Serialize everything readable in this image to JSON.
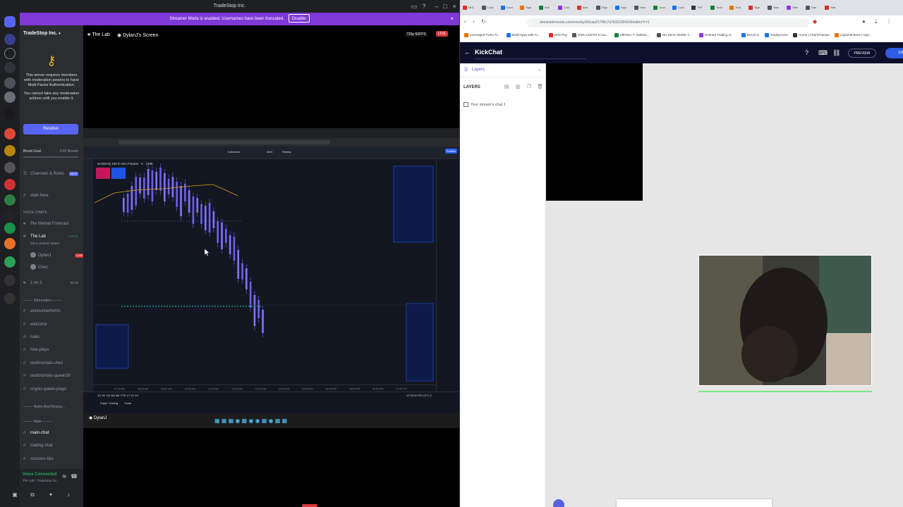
{
  "discord": {
    "window_title": "TradeStop Inc.",
    "banner_text": "Streamer Mode is enabled. Usernames have been truncated.",
    "banner_button": "Disable",
    "server_name": "TradeStop Inc.",
    "mfa_text_1": "This server requires members with moderation powers to have Multi-Factor Authentication.",
    "mfa_text_2": "You cannot take any moderation actions until you enable it.",
    "resolve_label": "Resolve",
    "boost_goal": "Boost Goal",
    "boost_count": "2/33 Boosts",
    "channels_roles": "Channels & Roles",
    "new_badge": "NEW",
    "start_here": "start-here",
    "voice_chats_cat": "VOICE CHATS",
    "pre_market": "Pre Market Forecast",
    "the_lab": "The Lab",
    "the_lab_time": "1:13:41",
    "channel_status": "Set a channel status",
    "user1": "DylanJ",
    "user2": "Chez",
    "live_badge": "LIVE",
    "one_on_one": "1 on 1",
    "one_on_one_count": "00",
    "one_on_one_max": "02",
    "info_cat": "Information",
    "announcements": "announcements",
    "welcome": "welcome",
    "rules": "rules",
    "free_plays": "free-plays",
    "testimonials_chez": "testimonials-chez",
    "testimonials_queen": "testimonials-queen30",
    "crypto": "crypto-queen-plays",
    "notes_cat": "Notes And Resour...",
    "main_cat": "Main",
    "main_chat": "main-chat",
    "trading_chat": "trading-chat",
    "success_tips": "success-tips",
    "voice_connected": "Voice Connected",
    "voice_sub": "The Lab / TradeStop Inc.",
    "stream_channel": "The Lab",
    "stream_screen": "DylanJ's Screen",
    "stream_quality": "720p 60FPS",
    "stream_live": "LIVE",
    "stream_user_label": "DylanJ"
  },
  "tradingview": {
    "symbol_line": "NASDAQ 100 E-mini Futures · 5 · CME",
    "bottom_tab_1": "Paper Trading",
    "bottom_tab_2": "Trade",
    "time_readout": "12:33:43 PM UTC-5",
    "toolbar_indicators": "Indicators",
    "toolbar_alert": "Alert",
    "toolbar_replay": "Replay",
    "toolbar_publish": "Publish",
    "time_labels": [
      "07:00 AM",
      "08:00 AM",
      "09:00 AM",
      "10:00 AM",
      "11:00 AM",
      "12:00 PM",
      "01:00 PM",
      "02:00 PM",
      "03:00 PM",
      "04:00 PM",
      "05:00 PM",
      "06:00 PM",
      "07:00 PM"
    ]
  },
  "browser": {
    "url": "streamelements.com/overlay/69caa31746c7a76321004166/editor?r=1",
    "tab_labels": [
      "MCL",
      "Lock",
      "Loca",
      "Sign",
      "Indi",
      "Colo",
      "Alex",
      "Elgo",
      "Sign",
      "How",
      "Loca",
      "Loca",
      "TRP",
      "Tonb",
      "Trad",
      "Sign",
      "How",
      "Sten",
      "Stre",
      "Stre"
    ],
    "bookmarks": [
      "Leveraged Turbo Tr...",
      "Build Apps with AI ...",
      "Rise Pay",
      "2026 Audi RS 6 Ava...",
      "UltFarm: F Taskbar...",
      "DH Demo Mobile T...",
      "Inverted Trading AI",
      "Bosch.in",
      "Tradeproven",
      "Home | ChartChamps",
      "Liquid Brokers | Ope..."
    ]
  },
  "streamelements": {
    "overlay_name": "KickChat",
    "preview": "PREVIEW",
    "save": "SAVE",
    "panel_title": "Layers",
    "layers_label": "LAYERS",
    "layer_item": "Your stream's chat 1"
  },
  "colors": {
    "discord_bg": "#2b2d31",
    "discord_banner": "#7e39d8",
    "blurple": "#5865f2",
    "live_red": "#da373c",
    "se_header": "#0d0f2b",
    "se_save": "#2e5ce6",
    "chart_candle": "#7b68ee",
    "chart_bg": "#131722"
  }
}
